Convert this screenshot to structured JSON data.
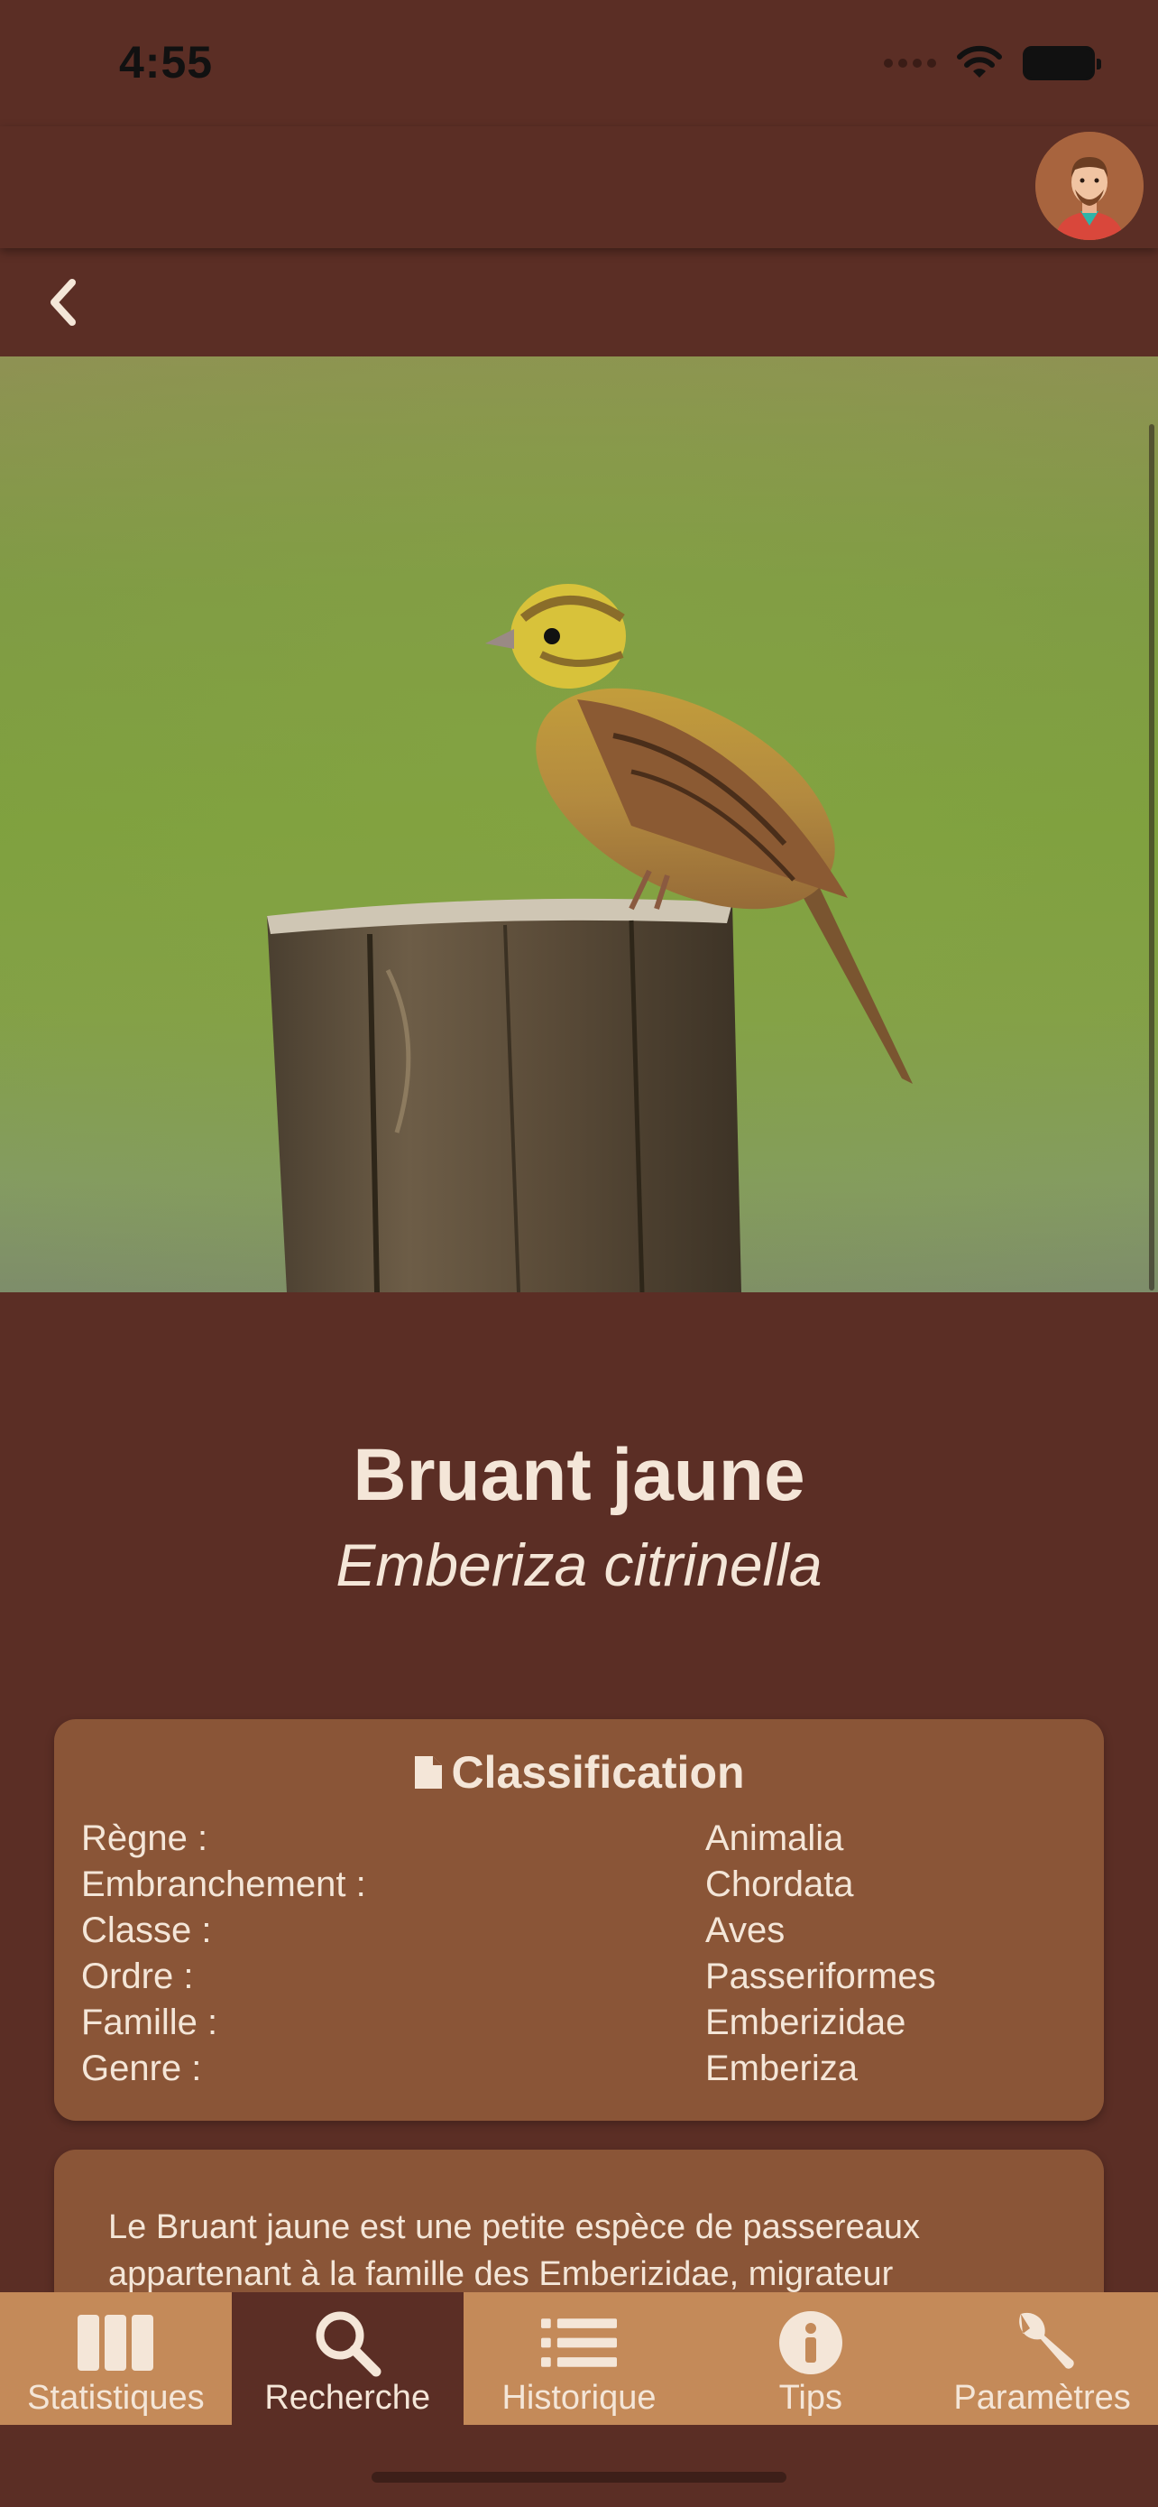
{
  "status_bar": {
    "time": "4:55"
  },
  "species": {
    "common_name": "Bruant jaune",
    "latin_name": "Emberiza citrinella"
  },
  "classification": {
    "title": "Classification",
    "rows": [
      {
        "key": "Règne :",
        "value": "Animalia"
      },
      {
        "key": "Embranchement :",
        "value": "Chordata"
      },
      {
        "key": "Classe :",
        "value": "Aves"
      },
      {
        "key": "Ordre :",
        "value": "Passeriformes"
      },
      {
        "key": "Famille :",
        "value": "Emberizidae"
      },
      {
        "key": "Genre :",
        "value": "Emberiza"
      }
    ]
  },
  "description": {
    "text": "Le Bruant jaune est une petite espèce de passereaux appartenant à la famille des Emberizidae, migrateur"
  },
  "tabs": [
    {
      "label": "Statistiques",
      "icon": "columns-icon",
      "active": false
    },
    {
      "label": "Recherche",
      "icon": "search-icon",
      "active": true
    },
    {
      "label": "Historique",
      "icon": "list-icon",
      "active": false
    },
    {
      "label": "Tips",
      "icon": "info-icon",
      "active": false
    },
    {
      "label": "Paramètres",
      "icon": "wrench-icon",
      "active": false
    }
  ],
  "colors": {
    "background": "#5b2e25",
    "card": "#8a5537",
    "tab_bar": "#c48a59",
    "text": "#f4e6d8"
  }
}
